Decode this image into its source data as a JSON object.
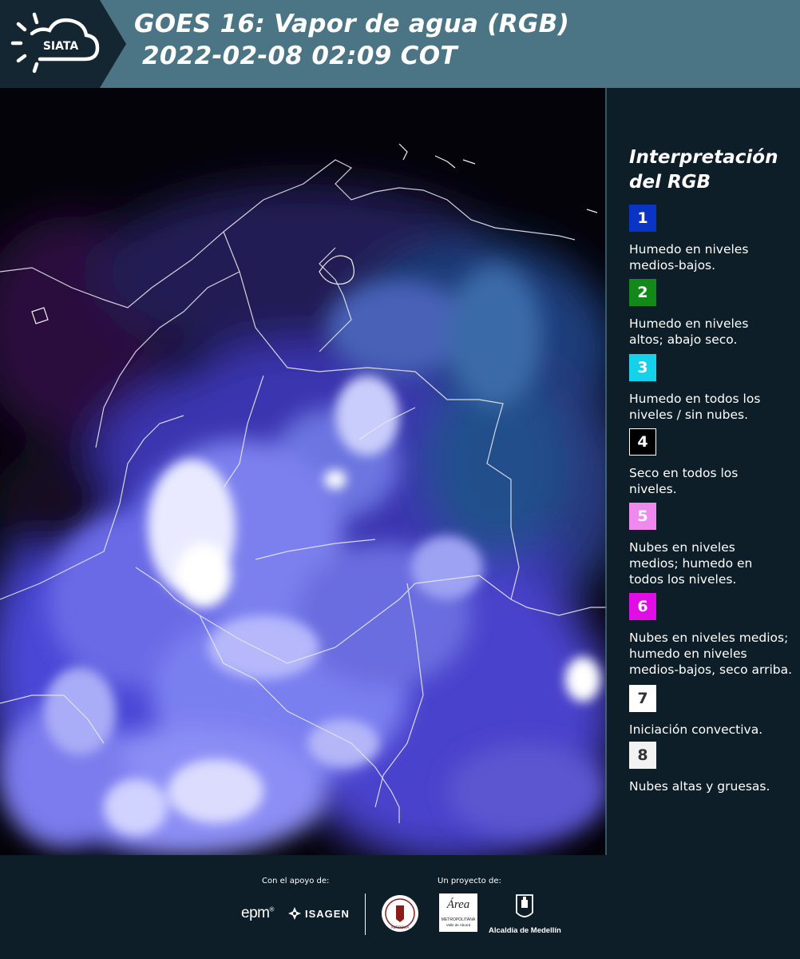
{
  "header": {
    "logo_text": "SIATA",
    "title_line1": "GOES 16: Vapor de agua (RGB)",
    "title_line2": "2022-02-08 02:09 COT"
  },
  "legend": {
    "title_line1": "Interpretación",
    "title_line2": "del RGB",
    "items": [
      {
        "num": "1",
        "color": "#0a35c4",
        "text_color": "#ffffff",
        "lines": [
          "Humedo en niveles",
          "medios-bajos."
        ]
      },
      {
        "num": "2",
        "color": "#13891a",
        "text_color": "#ffffff",
        "lines": [
          "Humedo en niveles",
          "altos; abajo seco."
        ]
      },
      {
        "num": "3",
        "color": "#15d2ea",
        "text_color": "#ffffff",
        "lines": [
          "Humedo en todos los",
          "niveles / sin nubes."
        ]
      },
      {
        "num": "4",
        "color": "#000000",
        "text_color": "#ffffff",
        "lines": [
          "Seco en todos los",
          "niveles."
        ]
      },
      {
        "num": "5",
        "color": "#f089ee",
        "text_color": "#ffffff",
        "lines": [
          "Nubes en niveles",
          "medios; humedo en",
          "todos los niveles."
        ]
      },
      {
        "num": "6",
        "color": "#e00ee5",
        "text_color": "#ffffff",
        "lines": [
          "Nubes en niveles medios;",
          "humedo en niveles",
          "medios-bajos, seco arriba."
        ]
      },
      {
        "num": "7",
        "color": "#ffffff",
        "text_color": "#333333",
        "lines": [
          "Iniciación convectiva."
        ]
      },
      {
        "num": "8",
        "color": "#f2f2f2",
        "text_color": "#333333",
        "lines": [
          "Nubes altas y gruesas."
        ]
      }
    ]
  },
  "footer": {
    "support_label": "Con el apoyo de:",
    "project_label": "Un proyecto de:",
    "epm": "epm",
    "isagen": "ISAGEN",
    "metro_area": "Área",
    "metro_sub": "METROPOLITANA",
    "metro_sub2": "Valle de Aburrá",
    "alcaldia": "Alcaldía de Medellín",
    "antioquia_seal": "ANTIOQUIA"
  }
}
